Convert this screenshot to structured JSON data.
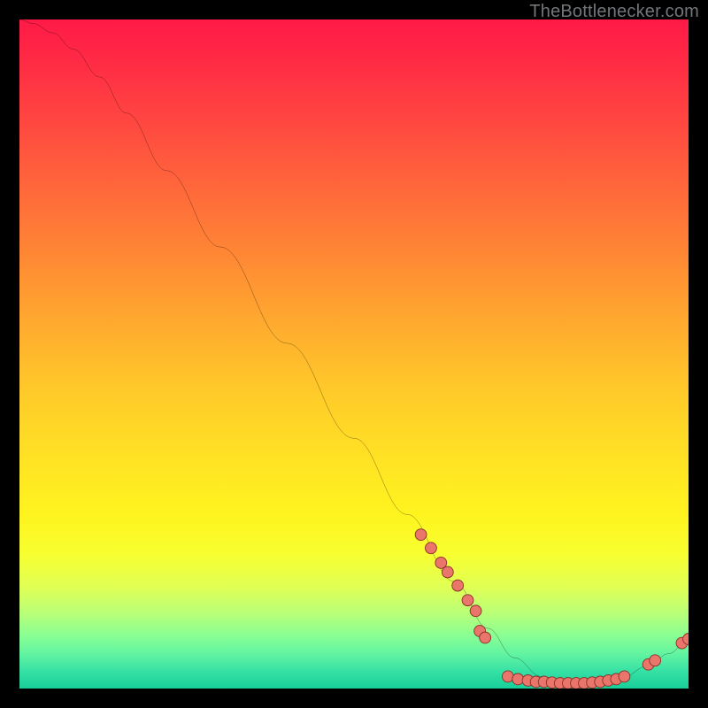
{
  "credit": "TheBottlenecker.com",
  "chart_data": {
    "type": "line",
    "title": "",
    "xlabel": "",
    "ylabel": "",
    "xlim": [
      0,
      100
    ],
    "ylim": [
      0,
      100
    ],
    "curve": [
      {
        "x": 0.0,
        "y": 100.0
      },
      {
        "x": 2.0,
        "y": 99.4
      },
      {
        "x": 5.0,
        "y": 98.0
      },
      {
        "x": 8.0,
        "y": 95.6
      },
      {
        "x": 12.0,
        "y": 91.4
      },
      {
        "x": 16.0,
        "y": 86.0
      },
      {
        "x": 22.0,
        "y": 77.4
      },
      {
        "x": 30.0,
        "y": 66.0
      },
      {
        "x": 40.0,
        "y": 51.6
      },
      {
        "x": 50.0,
        "y": 37.4
      },
      {
        "x": 58.0,
        "y": 26.0
      },
      {
        "x": 65.0,
        "y": 16.0
      },
      {
        "x": 70.0,
        "y": 9.0
      },
      {
        "x": 74.0,
        "y": 4.6
      },
      {
        "x": 78.0,
        "y": 1.8
      },
      {
        "x": 82.0,
        "y": 0.8
      },
      {
        "x": 86.0,
        "y": 0.8
      },
      {
        "x": 90.0,
        "y": 1.6
      },
      {
        "x": 94.0,
        "y": 3.4
      },
      {
        "x": 97.0,
        "y": 5.2
      },
      {
        "x": 100.0,
        "y": 7.2
      }
    ],
    "series": [
      {
        "name": "markers",
        "points": [
          {
            "x": 60.0,
            "y": 23.0
          },
          {
            "x": 61.5,
            "y": 21.0
          },
          {
            "x": 63.0,
            "y": 18.8
          },
          {
            "x": 64.0,
            "y": 17.4
          },
          {
            "x": 65.5,
            "y": 15.4
          },
          {
            "x": 67.0,
            "y": 13.2
          },
          {
            "x": 68.2,
            "y": 11.6
          },
          {
            "x": 68.8,
            "y": 8.6
          },
          {
            "x": 69.6,
            "y": 7.6
          },
          {
            "x": 73.0,
            "y": 1.8
          },
          {
            "x": 74.5,
            "y": 1.4
          },
          {
            "x": 76.0,
            "y": 1.2
          },
          {
            "x": 77.2,
            "y": 1.0
          },
          {
            "x": 78.4,
            "y": 1.0
          },
          {
            "x": 79.6,
            "y": 0.9
          },
          {
            "x": 80.8,
            "y": 0.8
          },
          {
            "x": 82.0,
            "y": 0.8
          },
          {
            "x": 83.2,
            "y": 0.8
          },
          {
            "x": 84.4,
            "y": 0.8
          },
          {
            "x": 85.6,
            "y": 0.9
          },
          {
            "x": 86.8,
            "y": 1.0
          },
          {
            "x": 88.0,
            "y": 1.2
          },
          {
            "x": 89.2,
            "y": 1.4
          },
          {
            "x": 90.4,
            "y": 1.8
          },
          {
            "x": 94.0,
            "y": 3.6
          },
          {
            "x": 95.0,
            "y": 4.2
          },
          {
            "x": 99.0,
            "y": 6.8
          },
          {
            "x": 100.0,
            "y": 7.4
          }
        ]
      }
    ],
    "colors": {
      "curve": "#000000",
      "marker_fill": "#e9756b",
      "marker_stroke": "#8a2f29"
    }
  }
}
